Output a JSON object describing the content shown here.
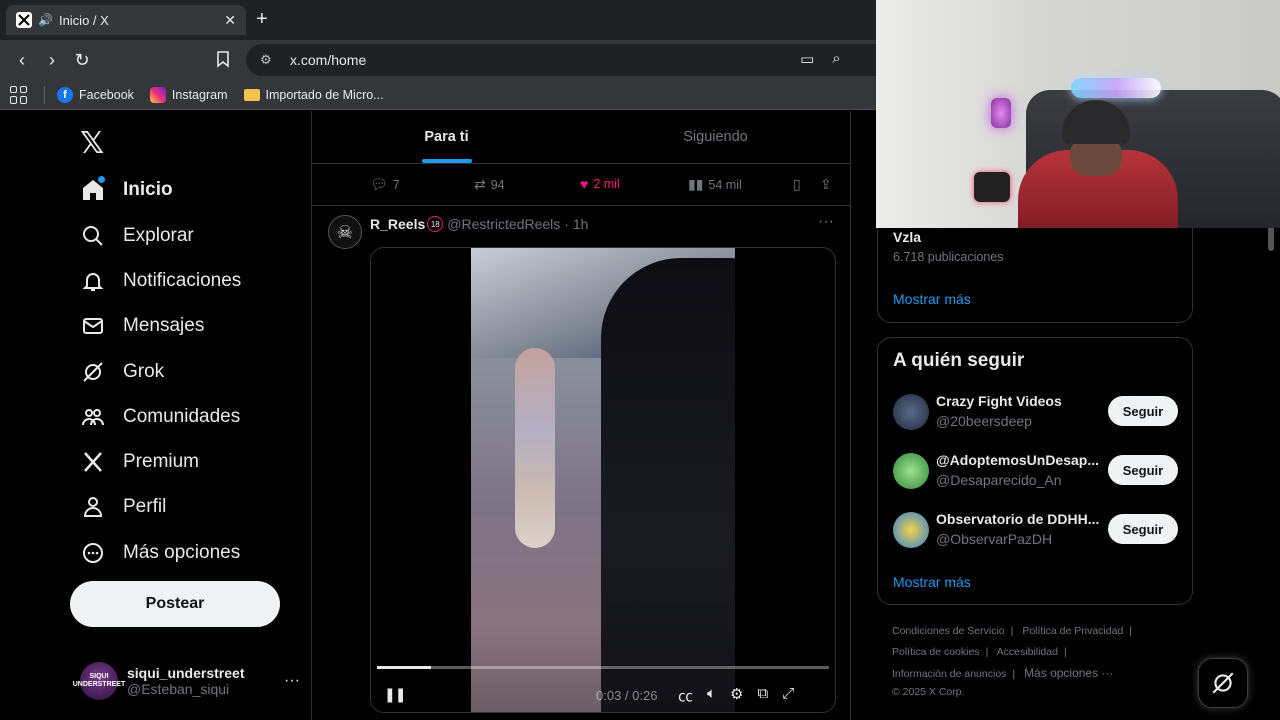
{
  "browser": {
    "tab_title": "Inicio / X",
    "tab_speaker": "🔊",
    "tab_close": "✕",
    "new_tab": "+",
    "url": "x.com/home",
    "bookmarks": [
      {
        "label": "Facebook"
      },
      {
        "label": "Instagram"
      },
      {
        "label": "Importado de Micro..."
      }
    ]
  },
  "sidebar": {
    "logo": "𝕏",
    "items": [
      {
        "label": "Inicio",
        "icon": "home-icon"
      },
      {
        "label": "Explorar",
        "icon": "search-icon"
      },
      {
        "label": "Notificaciones",
        "icon": "bell-icon"
      },
      {
        "label": "Mensajes",
        "icon": "mail-icon"
      },
      {
        "label": "Grok",
        "icon": "grok-icon"
      },
      {
        "label": "Comunidades",
        "icon": "people-icon"
      },
      {
        "label": "Premium",
        "icon": "x-icon"
      },
      {
        "label": "Perfil",
        "icon": "person-icon"
      },
      {
        "label": "Más opciones",
        "icon": "more-circle-icon"
      }
    ],
    "post_button": "Postear",
    "account": {
      "name": "siqui_understreet",
      "handle": "@Esteban_siqui",
      "avatar_text": "SIQUI UNDERSTREET",
      "more": "···"
    }
  },
  "main": {
    "tabs": [
      {
        "label": "Para ti"
      },
      {
        "label": "Siguiendo"
      }
    ],
    "prev_actions": {
      "replies": "7",
      "reposts": "94",
      "likes": "2 mil",
      "views": "54 mil"
    },
    "post": {
      "name": "R_Reels",
      "badge": "18",
      "handle": "@RestrictedReels",
      "time": "· 1h",
      "more": "···",
      "video": {
        "time": "0:03 / 0:26",
        "progress": 0.12
      }
    }
  },
  "right": {
    "trend": {
      "title": "Vzla",
      "count": "6.718 publicaciones",
      "show_more": "Mostrar más"
    },
    "who_to_follow": {
      "title": "A quién seguir",
      "accounts": [
        {
          "name": "Crazy Fight Videos",
          "handle": "@20beersdeep",
          "button": "Seguir"
        },
        {
          "name": "@AdoptemosUnDesap...",
          "handle": "@Desaparecido_An",
          "button": "Seguir"
        },
        {
          "name": "Observatorio de DDHH...",
          "handle": "@ObservarPazDH",
          "button": "Seguir"
        }
      ],
      "show_more": "Mostrar más"
    },
    "footer": {
      "links": [
        "Condiciones de Servicio",
        "Política de Privacidad",
        "Política de cookies",
        "Accesibilidad",
        "Información de anuncios",
        "Más opciones ···"
      ],
      "copyright": "© 2025 X Corp."
    }
  },
  "colors": {
    "accent": "#1d9bf0",
    "like": "#f91880",
    "background": "#000000",
    "border": "#2f3336"
  }
}
